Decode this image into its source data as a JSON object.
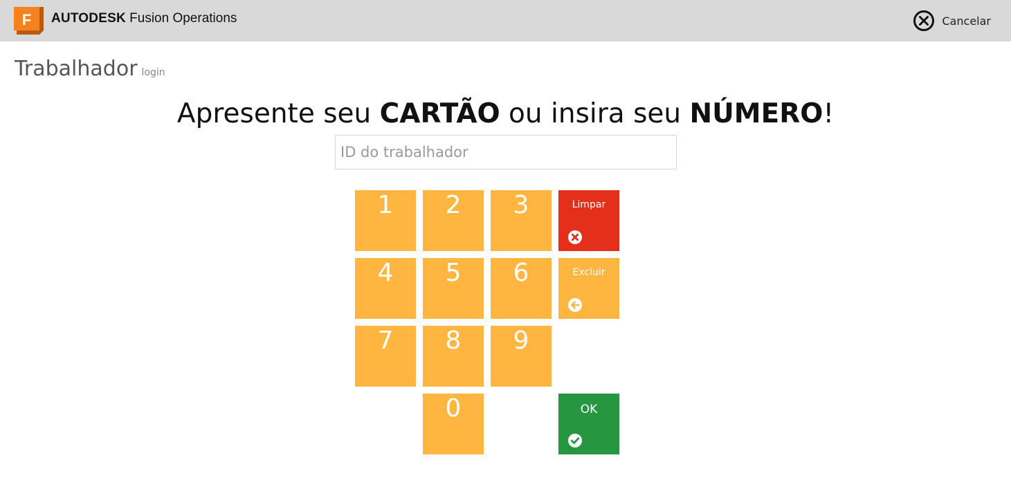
{
  "header": {
    "logo_letter": "F",
    "brand_bold": "AUTODESK",
    "brand_light": "Fusion Operations",
    "cancel_label": "Cancelar",
    "colors": {
      "bar": "#d9d9d9",
      "logo": "#f5821f"
    }
  },
  "page": {
    "title": "Trabalhador",
    "subtitle": "login"
  },
  "prompt": {
    "part1": "Apresente seu ",
    "strong1": "CARTÃO",
    "part2": " ou insira seu ",
    "strong2": "NÚMERO",
    "part3": "!"
  },
  "input": {
    "placeholder": "ID do trabalhador",
    "value": ""
  },
  "keypad": {
    "digits": [
      "1",
      "2",
      "3",
      "4",
      "5",
      "6",
      "7",
      "8",
      "9",
      "0"
    ],
    "clear_label": "Limpar",
    "clear_icon": "x-circle-icon",
    "delete_label": "Excluir",
    "delete_icon": "arrow-left-circle-icon",
    "ok_label": "OK",
    "ok_icon": "check-circle-icon",
    "colors": {
      "digit": "#ffb640",
      "clear": "#e4301a",
      "delete": "#ffb640",
      "ok": "#279640"
    }
  }
}
